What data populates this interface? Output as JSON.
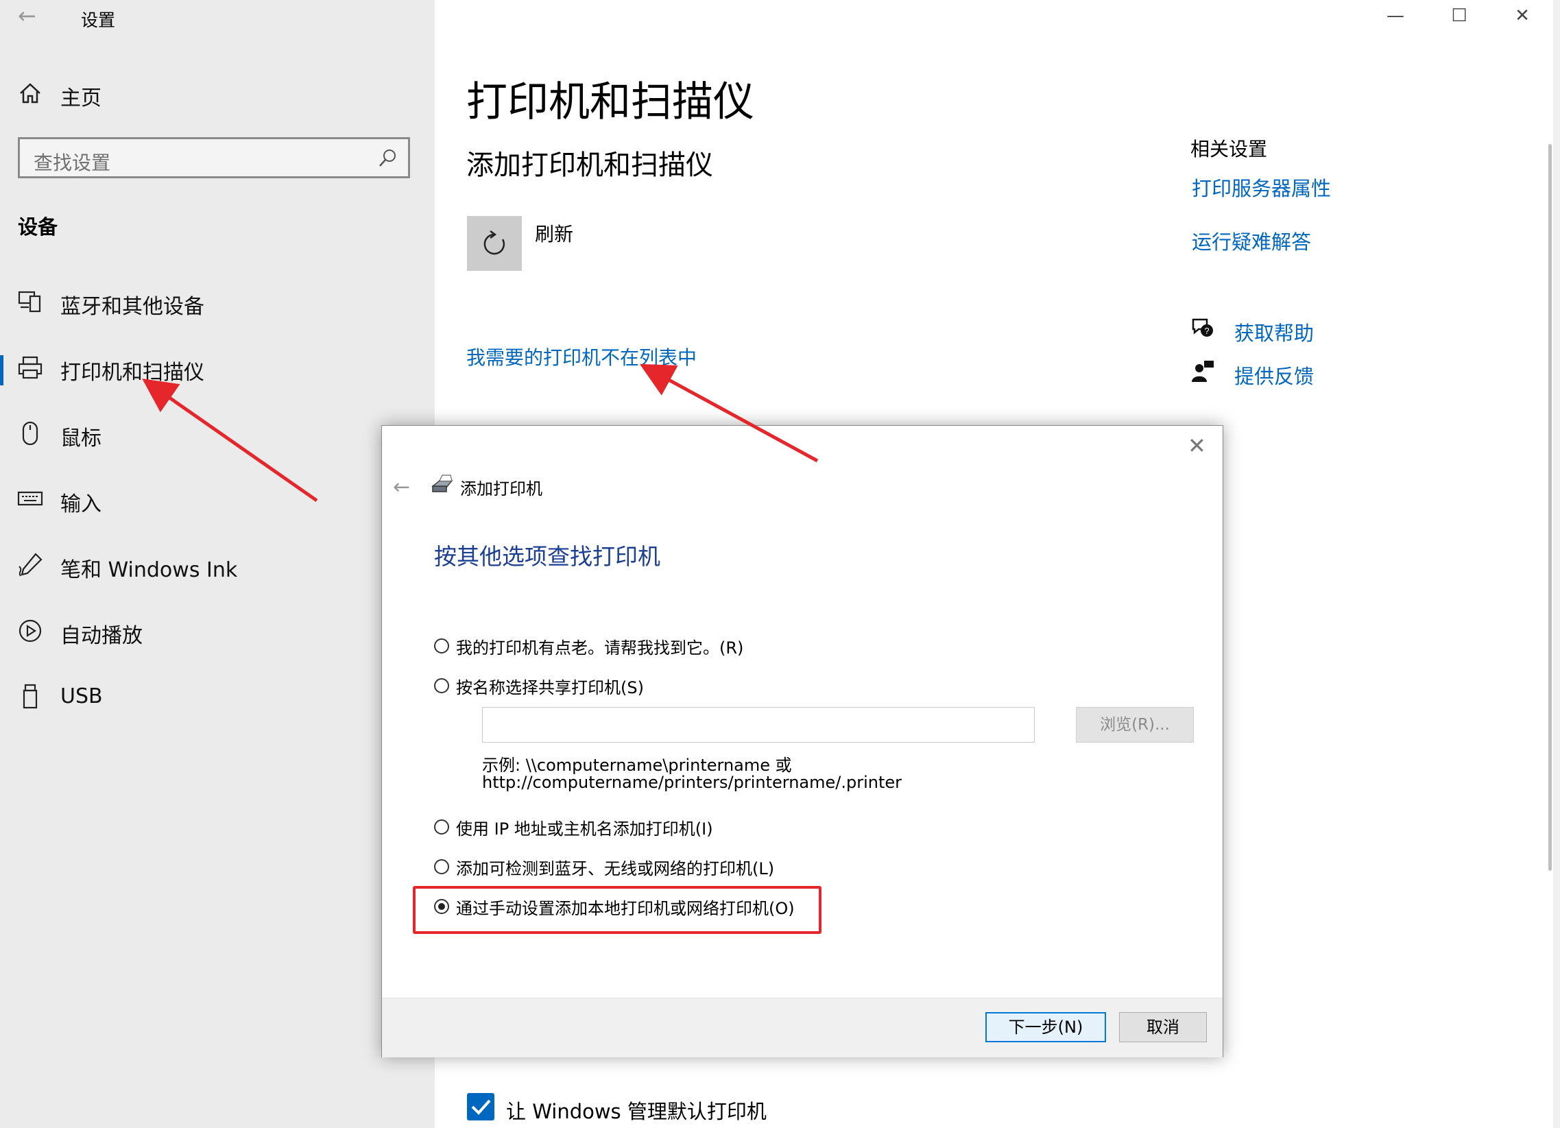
{
  "window": {
    "title": "设置",
    "back_glyph": "←",
    "minimize_glyph": "—",
    "maximize_glyph": "☐",
    "close_glyph": "✕"
  },
  "sidebar": {
    "home_label": "主页",
    "search_placeholder": "查找设置",
    "section_title": "设备",
    "items": [
      {
        "label": "蓝牙和其他设备",
        "icon": "bluetooth-devices-icon",
        "selected": false
      },
      {
        "label": "打印机和扫描仪",
        "icon": "printer-icon",
        "selected": true
      },
      {
        "label": "鼠标",
        "icon": "mouse-icon",
        "selected": false
      },
      {
        "label": "输入",
        "icon": "keyboard-icon",
        "selected": false
      },
      {
        "label": "笔和 Windows Ink",
        "icon": "pen-icon",
        "selected": false
      },
      {
        "label": "自动播放",
        "icon": "autoplay-icon",
        "selected": false
      },
      {
        "label": "USB",
        "icon": "usb-icon",
        "selected": false
      }
    ]
  },
  "main": {
    "page_title": "打印机和扫描仪",
    "sub_title": "添加打印机和扫描仪",
    "refresh_label": "刷新",
    "missing_printer_link": "我需要的打印机不在列表中",
    "related_title": "相关设置",
    "related_links": [
      "打印服务器属性",
      "运行疑难解答"
    ],
    "help_links": [
      {
        "label": "获取帮助",
        "icon": "help-chat-icon"
      },
      {
        "label": "提供反馈",
        "icon": "feedback-icon"
      }
    ],
    "default_printer_checkbox": {
      "label": "让 Windows 管理默认打印机",
      "checked": true
    }
  },
  "dialog": {
    "title": "添加打印机",
    "close_glyph": "✕",
    "heading": "按其他选项查找打印机",
    "options": [
      {
        "label": "我的打印机有点老。请帮我找到它。(R)",
        "selected": false
      },
      {
        "label": "按名称选择共享打印机(S)",
        "selected": false
      },
      {
        "label": "使用 IP 地址或主机名添加打印机(I)",
        "selected": false
      },
      {
        "label": "添加可检测到蓝牙、无线或网络的打印机(L)",
        "selected": false
      },
      {
        "label": "通过手动设置添加本地打印机或网络打印机(O)",
        "selected": true
      }
    ],
    "share_input_value": "",
    "browse_button": "浏览(R)...",
    "example_line1": "示例: \\\\computername\\printername 或",
    "example_line2": "http://computername/printers/printername/.printer",
    "next_button": "下一步(N)",
    "cancel_button": "取消"
  },
  "colors": {
    "accent": "#0067c0",
    "dialog_heading": "#1c3f94",
    "annotation_red": "#e5262a"
  }
}
